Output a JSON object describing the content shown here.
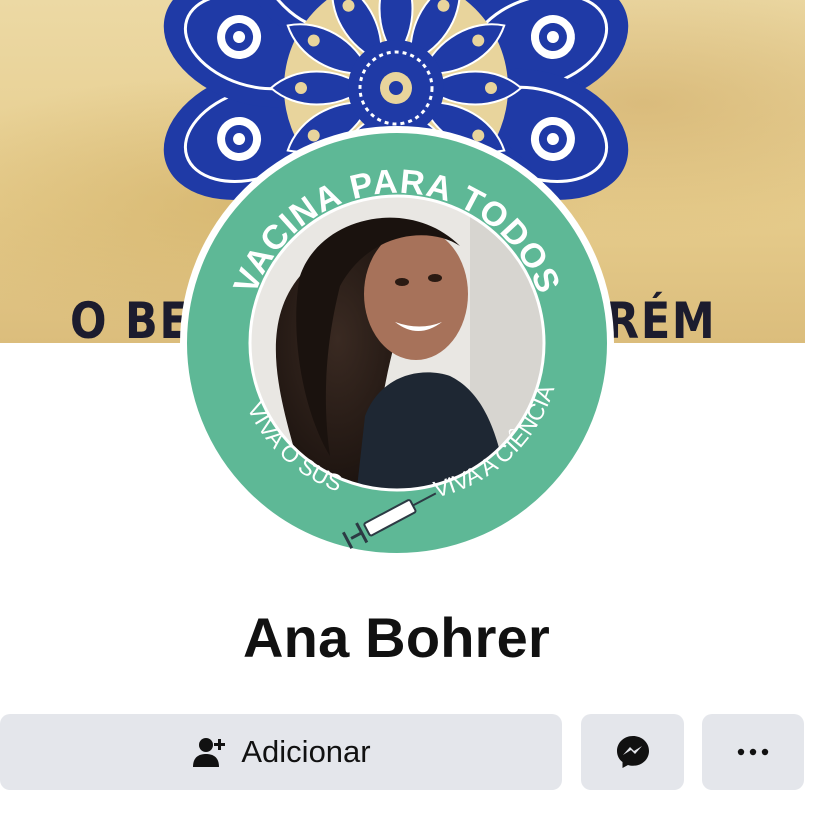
{
  "cover": {
    "text_left": "O BE",
    "text_right": "RÉM",
    "colors": {
      "mandala_blue": "#1f3aa6",
      "mandala_light": "#ffffff",
      "background": "#e8d49c"
    }
  },
  "avatar": {
    "frame_top_text": "VACINA PARA TODOS",
    "frame_bottom_left_text": "VIVA O SUS",
    "frame_bottom_right_text": "VIVA A CIÊNCIA",
    "frame_color": "#5eb896",
    "syringe_icon": "syringe-icon"
  },
  "profile": {
    "name": "Ana Bohrer"
  },
  "actions": {
    "add_label": "Adicionar",
    "add_icon": "add-friend-icon",
    "message_icon": "messenger-icon",
    "more_icon": "more-icon",
    "button_bg": "#e4e6eb"
  }
}
